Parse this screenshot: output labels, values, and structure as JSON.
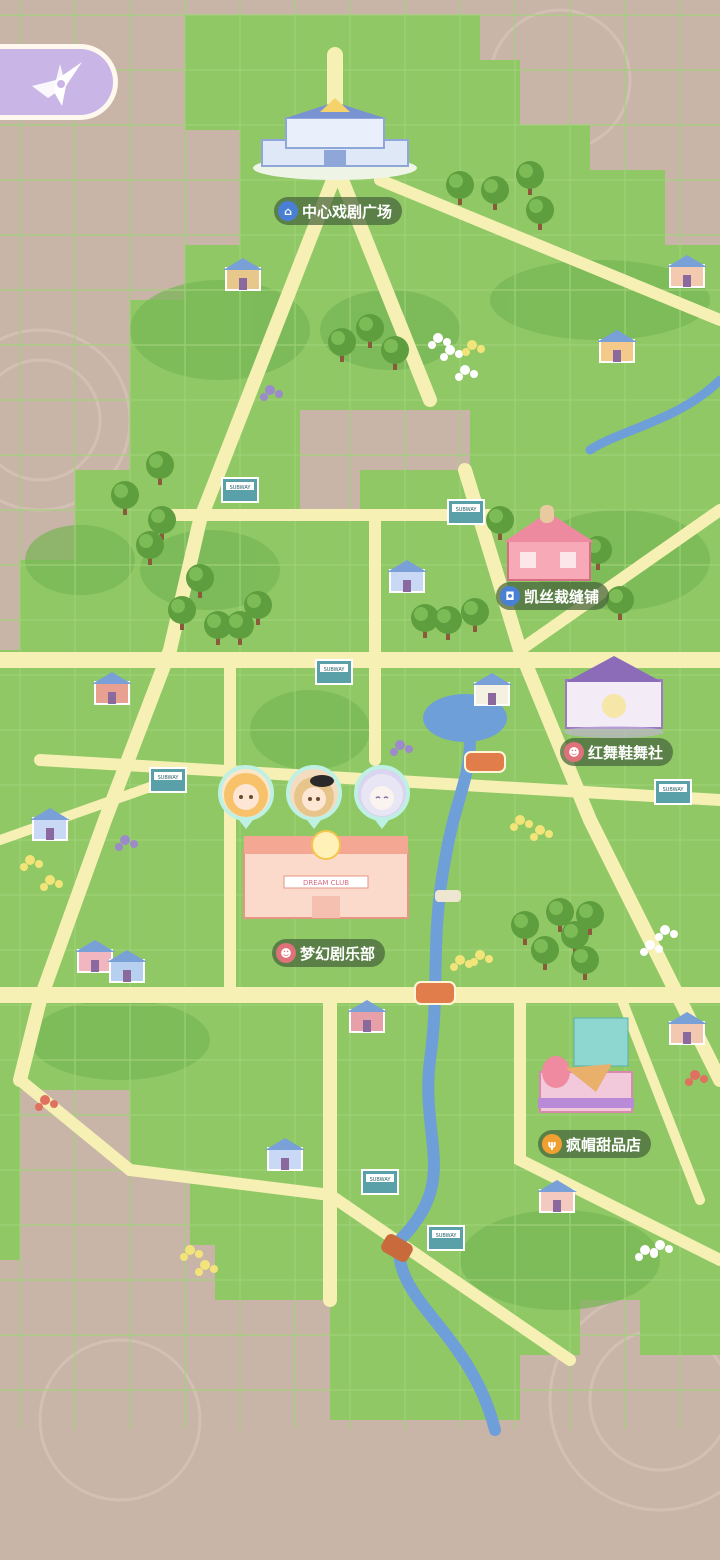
{
  "ui": {
    "back_icon": "compass-star-icon"
  },
  "locations": [
    {
      "id": "central-plaza",
      "name": "中心戏剧广场",
      "icon": "museum-icon",
      "icon_color": "#4a7fd6"
    },
    {
      "id": "tailor-shop",
      "name": "凯丝裁缝铺",
      "icon": "shopping-bag-icon",
      "icon_color": "#4a7fd6"
    },
    {
      "id": "dance-club",
      "name": "红舞鞋舞社",
      "icon": "theater-mask-icon",
      "icon_color": "#e0707a"
    },
    {
      "id": "dream-club",
      "name": "梦幻剧乐部",
      "icon": "theater-mask-icon",
      "icon_color": "#e0707a"
    },
    {
      "id": "dessert-shop",
      "name": "疯帽甜品店",
      "icon": "fork-knife-icon",
      "icon_color": "#f0a030"
    }
  ],
  "characters": [
    {
      "name": "character-avatar-blonde",
      "hair_color": "#f7c26a",
      "bg_color": "#fde6c8"
    },
    {
      "name": "character-avatar-hat",
      "hair_color": "#e7c48a",
      "bg_color": "#f3dcc0"
    },
    {
      "name": "character-avatar-silver",
      "hair_color": "#e8e6f4",
      "bg_color": "#d9d4f0"
    }
  ],
  "signs": {
    "subway": "SUBWAY",
    "club": "DREAM CLUB"
  },
  "colors": {
    "grass": "#8fc865",
    "grass_dark": "#76b554",
    "road": "#f6f0b4",
    "river": "#6e9fd9",
    "ground": "#c9b5a8"
  }
}
